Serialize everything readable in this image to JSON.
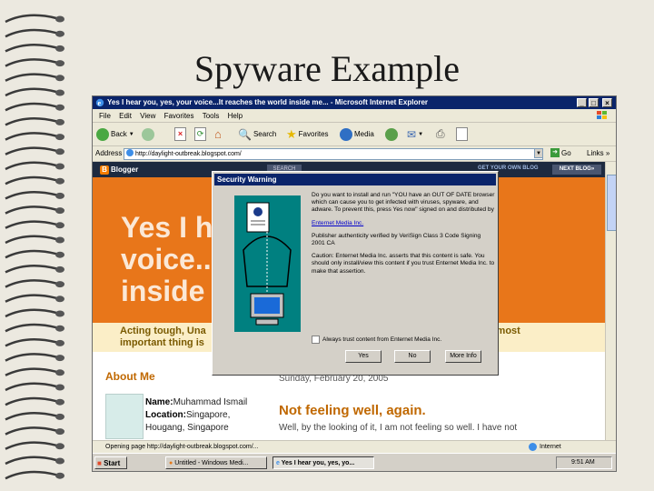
{
  "slide": {
    "title": "Spyware Example"
  },
  "browser": {
    "window_title": "Yes I hear you, yes, your voice...It reaches the world inside me... - Microsoft Internet Explorer",
    "window_buttons": [
      "_",
      "□",
      "×"
    ],
    "menu": [
      "File",
      "Edit",
      "View",
      "Favorites",
      "Tools",
      "Help"
    ],
    "toolbar": {
      "back": "Back",
      "search": "Search",
      "favorites": "Favorites",
      "media": "Media"
    },
    "address": {
      "label": "Address",
      "value": "http://daylight-outbreak.blogspot.com/",
      "go": "Go",
      "links": "Links"
    },
    "status": {
      "text": "Opening page http://daylight-outbreak.blogspot.com/...",
      "zone": "Internet"
    }
  },
  "blog": {
    "logo": "Blogger",
    "search_button": "SEARCH",
    "get_own": "GET YOUR OWN BLOG",
    "next_blog": "NEXT BLOG»",
    "banner": "Yes I hear you, yes, your\nvoice...It reaches the world\ninside me...",
    "subhead_line1": "Acting tough, Una",
    "subhead_line2": "important thing is",
    "subhead_right": "the most",
    "about_me": "About Me",
    "profile": {
      "name_label": "Name:",
      "name": "Muhammad Ismail",
      "location_label": "Location:",
      "location": "Singapore,",
      "location2": "Hougang, Singapore"
    },
    "post_date": "Sunday, February 20, 2005",
    "post_title": "Not feeling well, again.",
    "post_body": "Well, by the looking of it, I am not feeling so well. I have not"
  },
  "dialog": {
    "title": "Security Warning",
    "paragraph1": "Do you want to install and run \"YOU have an OUT OF DATE browser which can cause you to get infected with viruses, spyware, and adware. To prevent this, press Yes now\" signed on and distributed by",
    "publisher_link": "Enternet Media Inc.",
    "paragraph2": "Publisher authenticity verified by VeriSign Class 3 Code Signing 2001 CA",
    "paragraph3": "Caution: Enternet Media Inc. asserts that this content is safe. You should only install/view this content if you trust Enternet Media Inc. to make that assertion.",
    "checkbox_label": "Always trust content from Enternet Media Inc.",
    "buttons": {
      "yes": "Yes",
      "no": "No",
      "more_info": "More Info"
    }
  },
  "taskbar": {
    "start": "Start",
    "tasks": [
      "Untitled - Windows Medi...",
      "Yes I hear you, yes, yo..."
    ],
    "clock": "9:51 AM"
  }
}
